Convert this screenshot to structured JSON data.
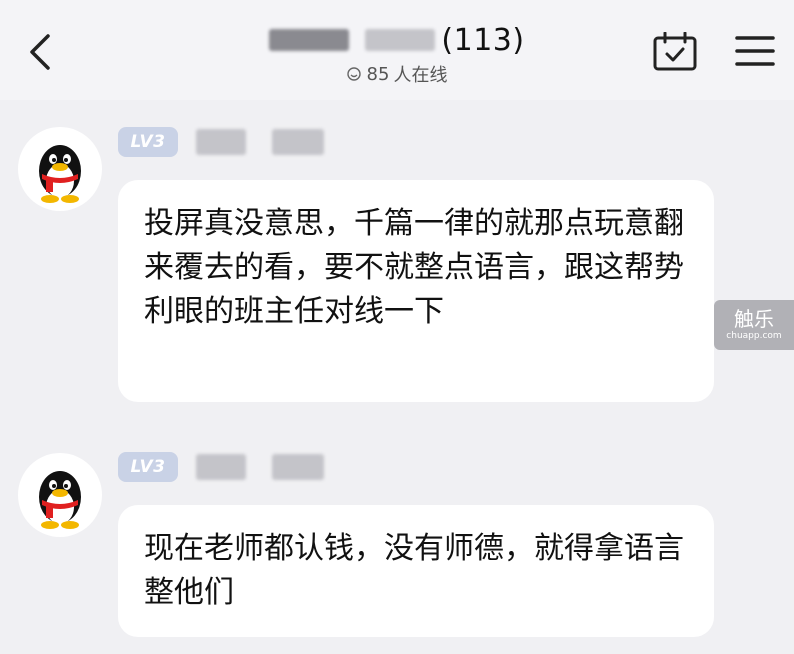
{
  "header": {
    "member_count": "(113)",
    "online_count": "85",
    "online_suffix": "人在线"
  },
  "messages": [
    {
      "level": "LV3",
      "text": "投屏真没意思，千篇一律的就那点玩意翻来覆去的看，要不就整点语言，跟这帮势利眼的班主任对线一下"
    },
    {
      "level": "LV3",
      "text": "现在老师都认钱，没有师德，就得拿语言整他们"
    }
  ],
  "watermark": {
    "main": "触乐",
    "sub": "chuapp.com"
  },
  "icons": [
    "back-icon",
    "calendar-check-icon",
    "menu-icon",
    "qq-penguin-icon",
    "online-smile-icon"
  ]
}
